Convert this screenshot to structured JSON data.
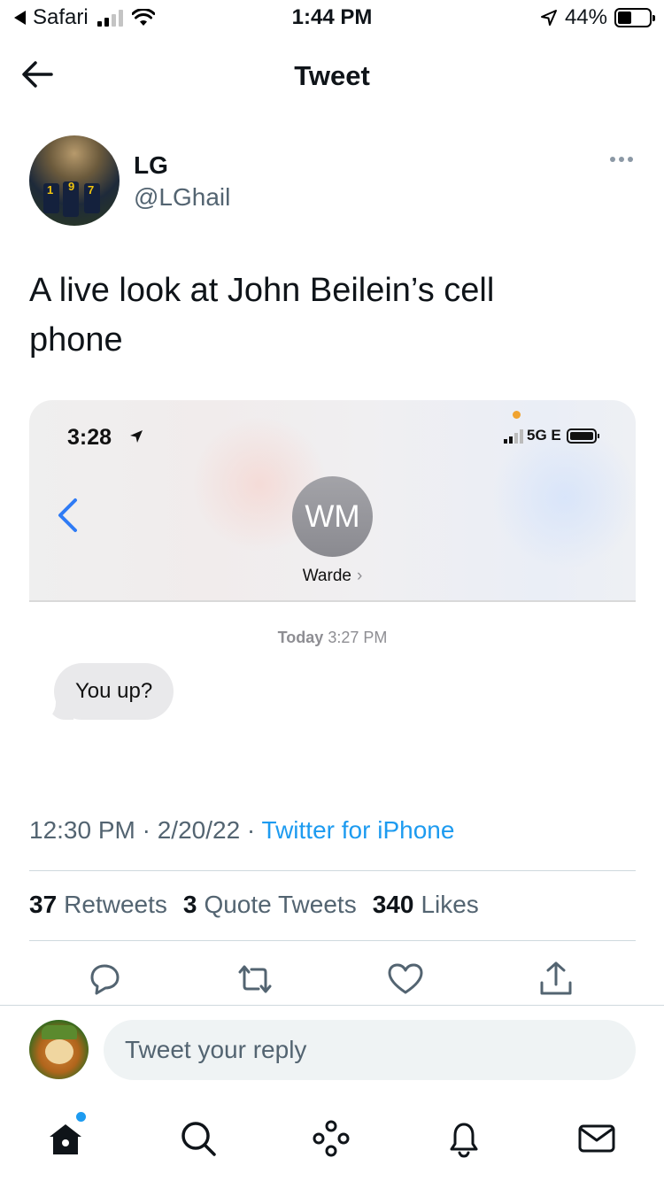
{
  "status_bar": {
    "back_app": "Safari",
    "time": "1:44 PM",
    "battery": "44%",
    "battery_level": 0.44,
    "icons": [
      "back-triangle-icon",
      "cell-signal-icon",
      "wifi-icon",
      "location-arrow-icon",
      "battery-icon"
    ]
  },
  "header": {
    "title": "Tweet",
    "back_icon": "back-arrow-icon"
  },
  "tweet": {
    "author_name": "LG",
    "author_handle": "@LGhail",
    "text": "A live look at John Beilein’s cell phone",
    "timestamp": "12:30 PM · 2/20/22 · ",
    "source": "Twitter for iPhone",
    "stats": {
      "retweets_count": "37",
      "retweets_label": "Retweets",
      "quotes_count": "3",
      "quotes_label": "Quote Tweets",
      "likes_count": "340",
      "likes_label": "Likes"
    }
  },
  "media": {
    "time": "3:28",
    "network": "5G E",
    "contact_initials": "WM",
    "contact_name": "Warde",
    "date_day": "Today",
    "date_time": "3:27 PM",
    "message": "You up?"
  },
  "reply": {
    "placeholder": "Tweet your reply"
  },
  "colors": {
    "accent": "#1d9bf0",
    "text": "#0f1419",
    "secondary": "#536471",
    "bubble": "#e9e9eb"
  }
}
